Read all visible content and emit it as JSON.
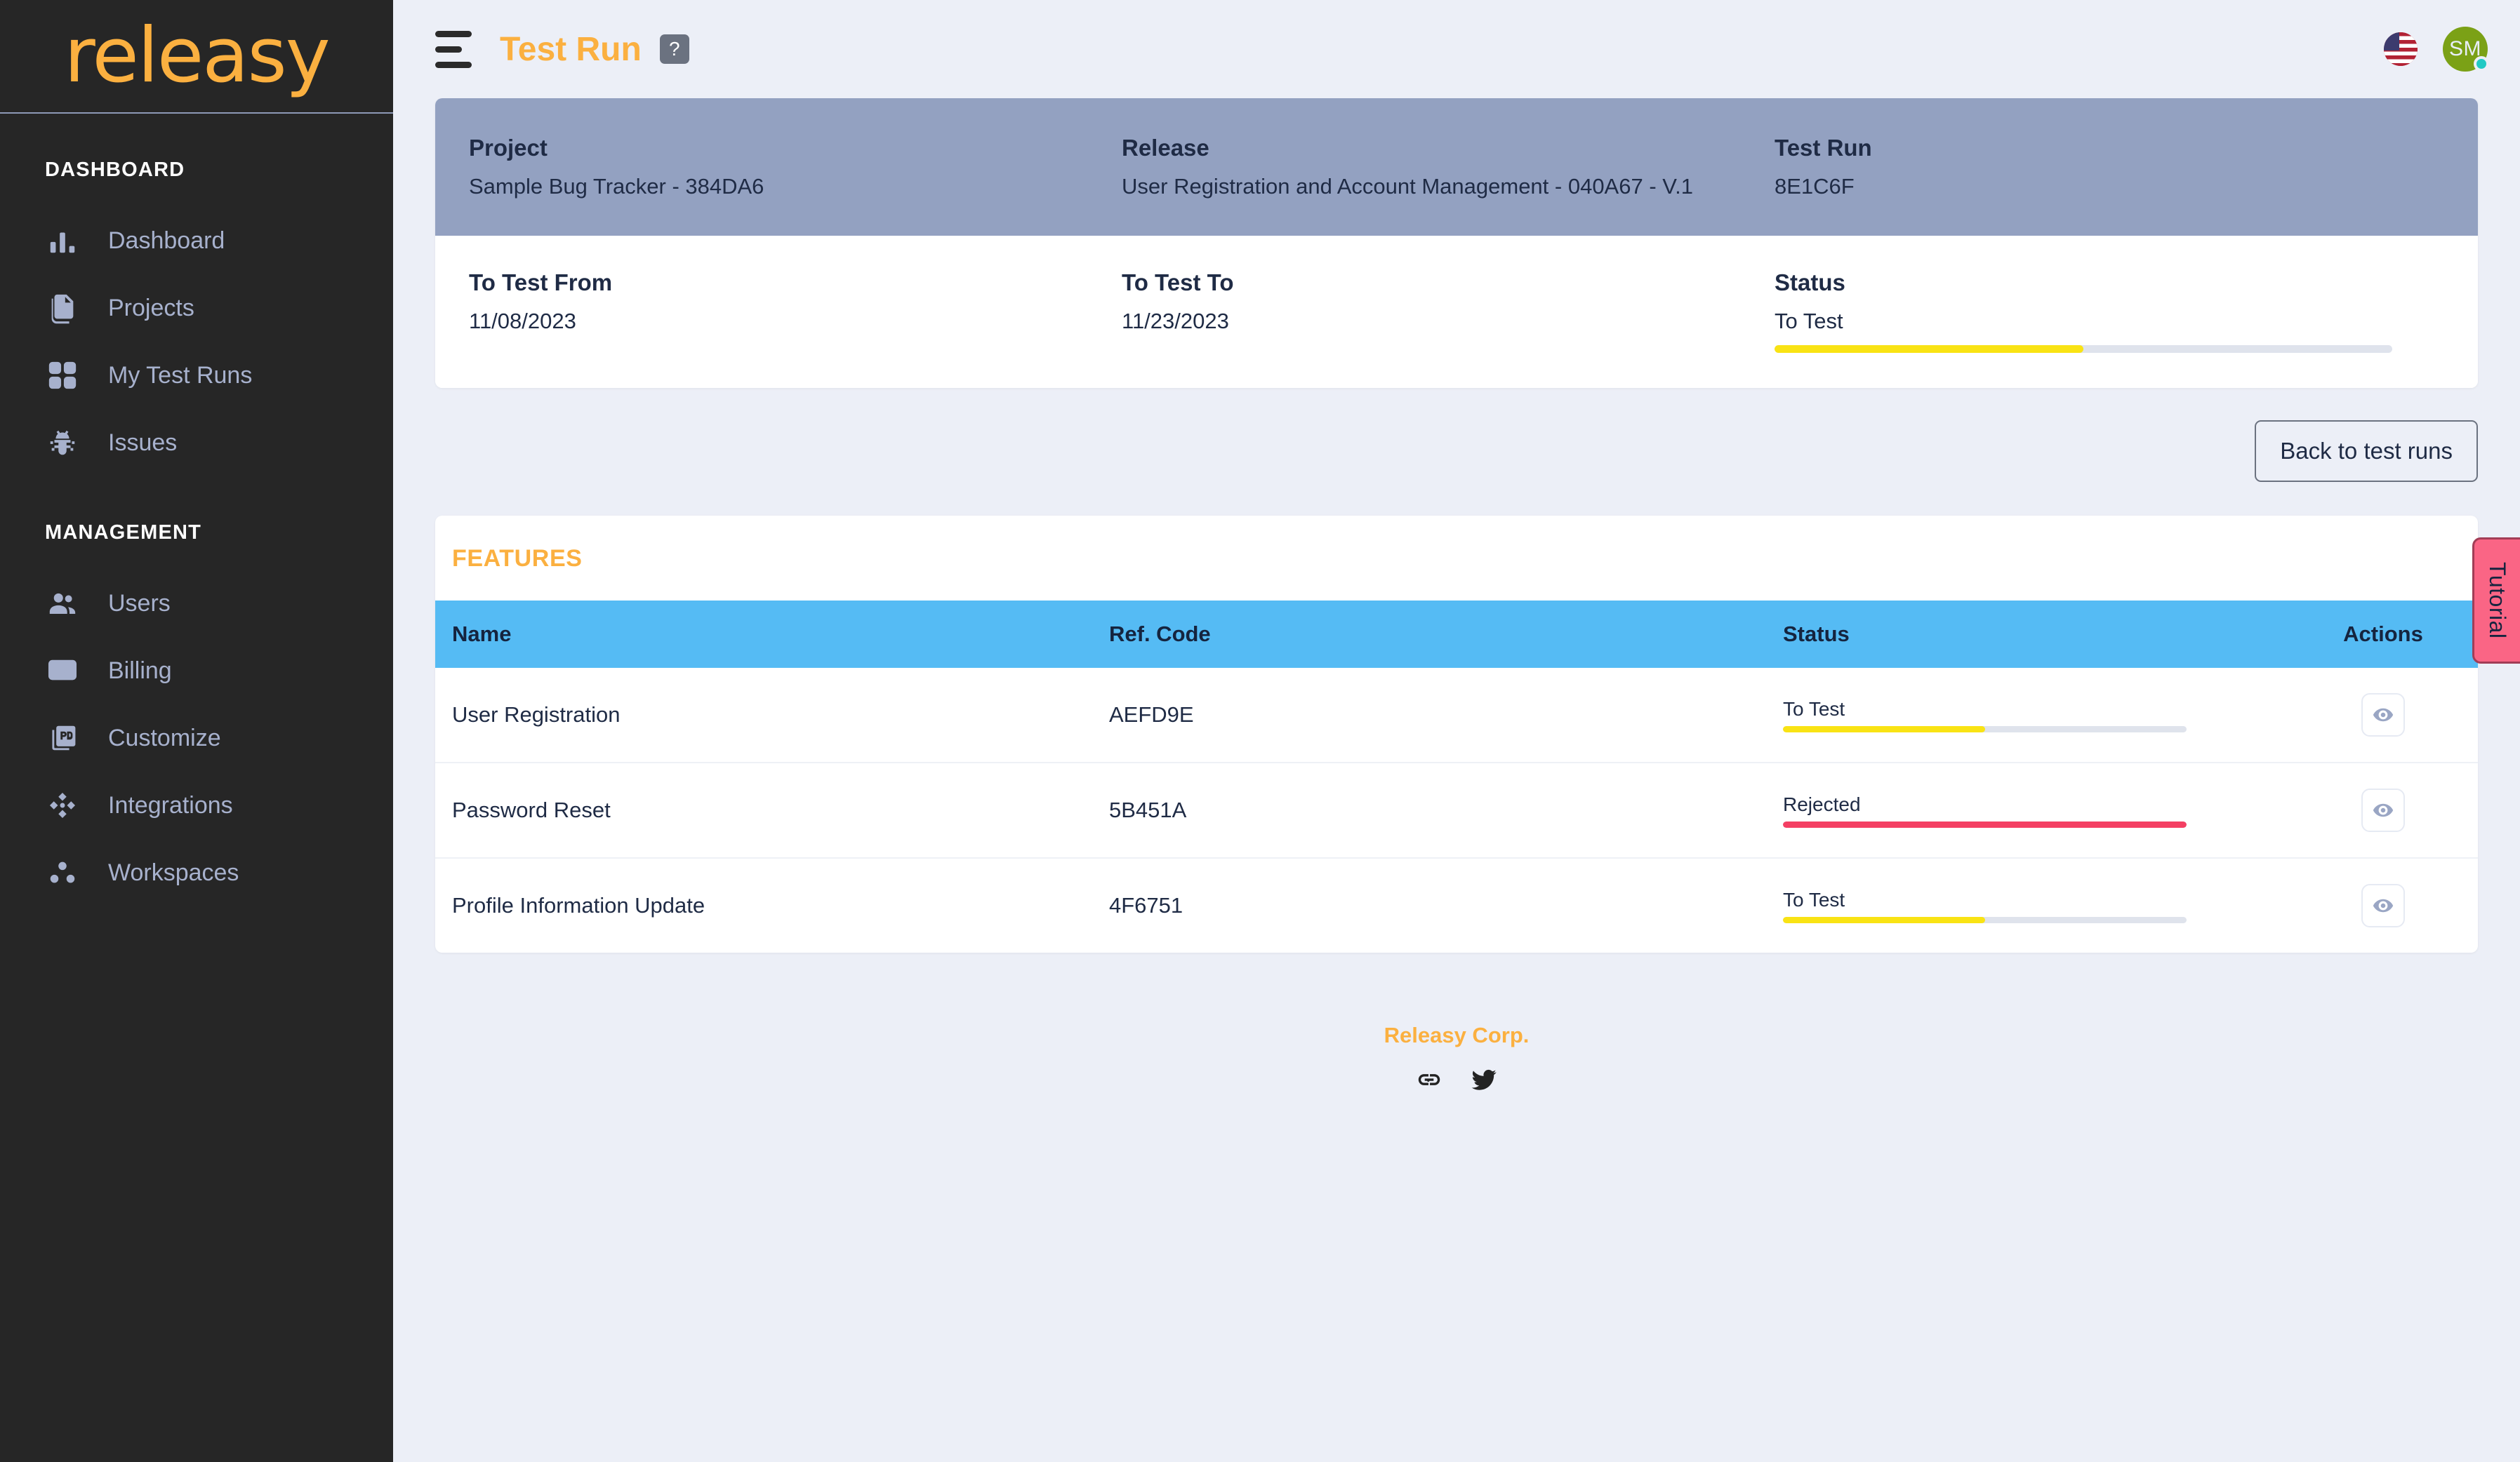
{
  "brand": {
    "name": "releasy"
  },
  "sidebar": {
    "sections": [
      {
        "title": "DASHBOARD",
        "items": [
          {
            "label": "Dashboard",
            "icon": "bar-chart-icon"
          },
          {
            "label": "Projects",
            "icon": "documents-icon"
          },
          {
            "label": "My Test Runs",
            "icon": "grid-icon"
          },
          {
            "label": "Issues",
            "icon": "bug-icon"
          }
        ]
      },
      {
        "title": "MANAGEMENT",
        "items": [
          {
            "label": "Users",
            "icon": "people-icon"
          },
          {
            "label": "Billing",
            "icon": "credit-card-check-icon"
          },
          {
            "label": "Customize",
            "icon": "pdf-document-icon"
          },
          {
            "label": "Integrations",
            "icon": "diamond-nodes-icon"
          },
          {
            "label": "Workspaces",
            "icon": "three-dots-icon"
          }
        ]
      }
    ]
  },
  "topbar": {
    "title": "Test Run",
    "help_label": "?",
    "language_flag": "us-flag-icon",
    "avatar_initials": "SM"
  },
  "info_card": {
    "project_label": "Project",
    "project_value": "Sample Bug Tracker - 384DA6",
    "release_label": "Release",
    "release_value": "User Registration and Account Management - 040A67 - V.1",
    "test_run_label": "Test Run",
    "test_run_value": "8E1C6F",
    "to_test_from_label": "To Test From",
    "to_test_from_value": "11/08/2023",
    "to_test_to_label": "To Test To",
    "to_test_to_value": "11/23/2023",
    "status_label": "Status",
    "status_value": "To Test",
    "status_percent": 50,
    "status_color": "#f9e314"
  },
  "actions": {
    "back_label": "Back to test runs"
  },
  "features": {
    "panel_title": "FEATURES",
    "columns": {
      "name": "Name",
      "ref_code": "Ref. Code",
      "status": "Status",
      "actions": "Actions"
    },
    "rows": [
      {
        "name": "User Registration",
        "ref_code": "AEFD9E",
        "status": "To Test",
        "status_percent": 50,
        "status_color": "#f9e314",
        "action_icon": "eye-icon"
      },
      {
        "name": "Password Reset",
        "ref_code": "5B451A",
        "status": "Rejected",
        "status_percent": 100,
        "status_color": "#f43f63",
        "action_icon": "eye-icon"
      },
      {
        "name": "Profile Information Update",
        "ref_code": "4F6751",
        "status": "To Test",
        "status_percent": 50,
        "status_color": "#f9e314",
        "action_icon": "eye-icon"
      }
    ]
  },
  "footer": {
    "company": "Releasy Corp.",
    "icons": [
      "link-icon",
      "twitter-icon"
    ]
  },
  "tutorial": {
    "label": "Tutorial",
    "color": "#fa6585"
  }
}
